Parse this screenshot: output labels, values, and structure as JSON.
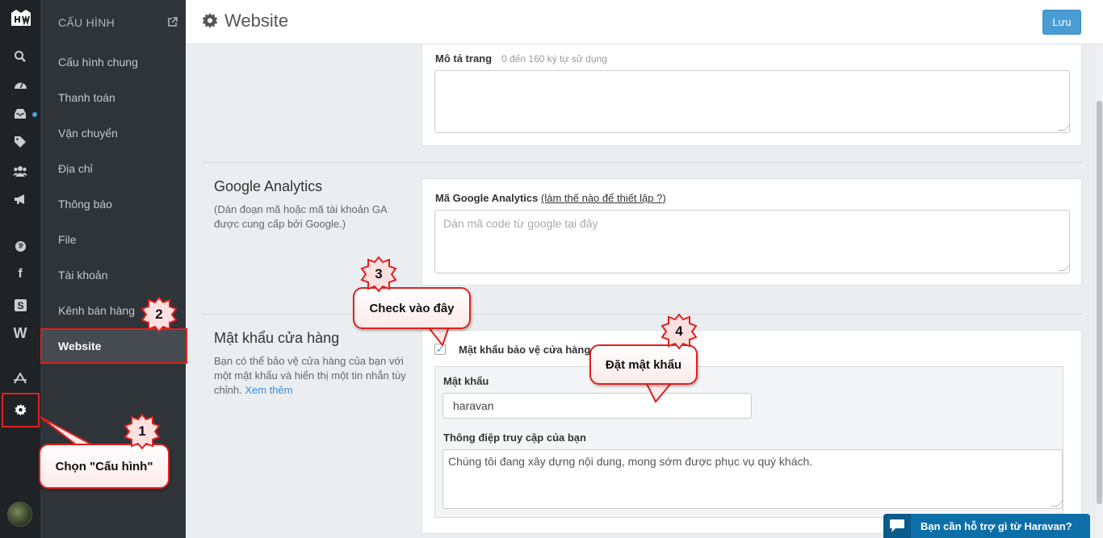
{
  "sidebar": {
    "header": "CẤU HÌNH",
    "items": [
      {
        "label": "Cấu hình chung"
      },
      {
        "label": "Thanh toán"
      },
      {
        "label": "Vận chuyển"
      },
      {
        "label": "Địa chỉ"
      },
      {
        "label": "Thông báo"
      },
      {
        "label": "File"
      },
      {
        "label": "Tài khoản"
      },
      {
        "label": "Kênh bán hàng"
      },
      {
        "label": "Website"
      }
    ]
  },
  "header": {
    "title": "Website",
    "save_label": "Lưu"
  },
  "page_description": {
    "label": "Mô tả trang",
    "hint": "0 đến 160 ký tự sử dụng"
  },
  "google_analytics": {
    "title": "Google Analytics",
    "description": "(Dán đoạn mã hoặc mã tài khoản GA được cung cấp bởi Google.)",
    "field_label": "Mã Google Analytics",
    "help_link": "(làm thế nào để thiết lập ?)",
    "placeholder": "Dán mã code từ google tại đây"
  },
  "store_password": {
    "title": "Mật khẩu cửa hàng",
    "description": "Bạn có thể bảo vệ cửa hàng của bạn với một mật khẩu và hiển thị một tin nhắn tùy chỉnh.",
    "see_more": "Xem thêm",
    "checkbox_label": "Mật khẩu bảo vệ cửa hàng",
    "checked": true,
    "password_label": "Mật khẩu",
    "password_value": "haravan",
    "message_label": "Thông điệp truy cập của bạn",
    "message_value": "Chúng tôi đang xây dựng nội dung, mong sớm được phục vụ quý khách."
  },
  "chat_widget": {
    "label": "Bạn cần hỗ trợ gì từ Haravan?"
  },
  "annotations": [
    {
      "number": "1",
      "text": "Chọn \"Cấu hình\""
    },
    {
      "number": "2",
      "text": ""
    },
    {
      "number": "3",
      "text": "Check vào đây"
    },
    {
      "number": "4",
      "text": "Đặt mật khẩu"
    }
  ],
  "colors": {
    "accent": "#4a9cd4",
    "annotation": "#e02020",
    "rail": "#1f2326",
    "sidebar": "#2f3438"
  },
  "icons": [
    "logo-icon",
    "search-icon",
    "dashboard-icon",
    "inbox-icon",
    "tag-icon",
    "users-icon",
    "megaphone-icon",
    "globe-icon",
    "facebook-icon",
    "s-icon",
    "w-icon",
    "apps-icon",
    "gear-icon",
    "external-link-icon",
    "chat-icon"
  ]
}
